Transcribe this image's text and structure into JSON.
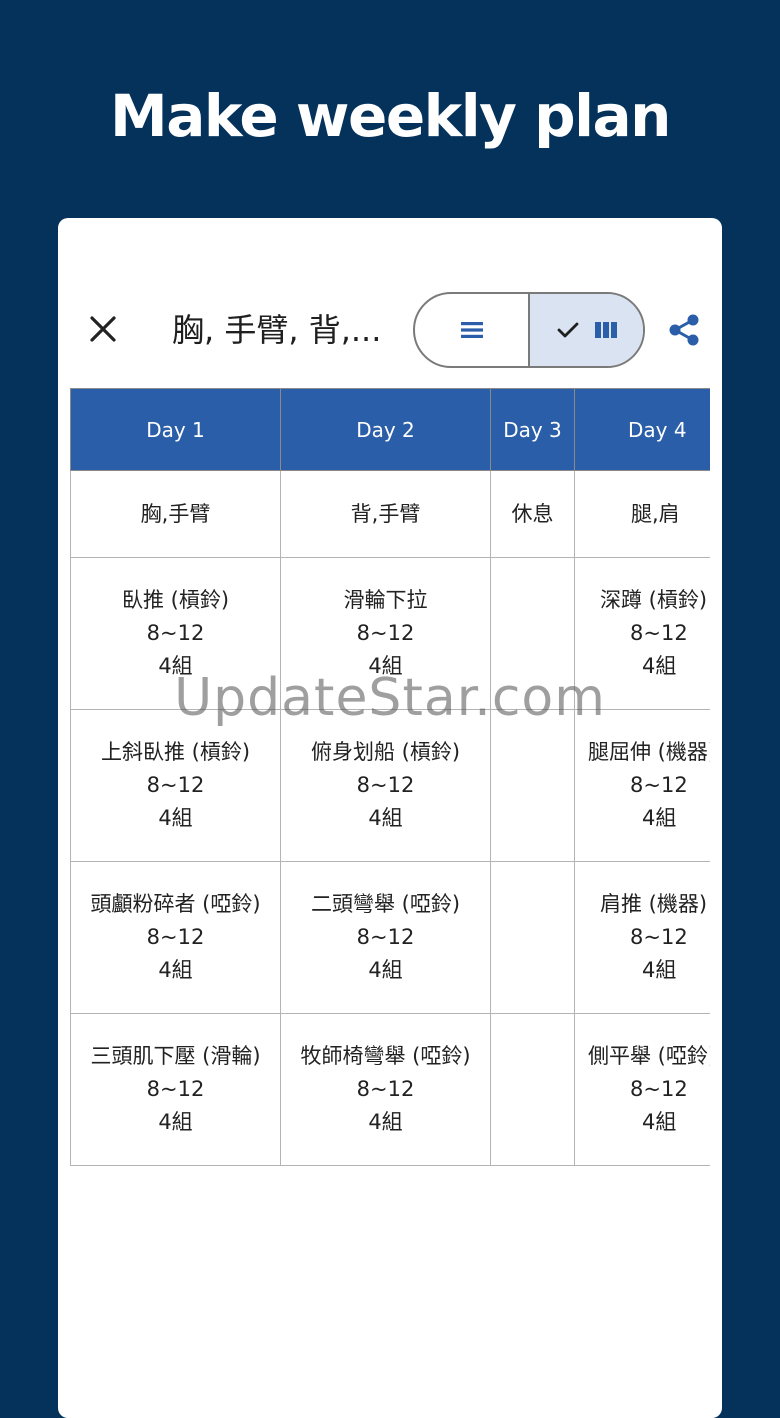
{
  "headline": "Make weekly plan",
  "toolbar": {
    "title": "胸, 手臂, 背,...",
    "close_icon": "close-icon",
    "list_view_icon": "list-icon",
    "grid_view_icon": "columns-icon",
    "selected_icon": "check-icon",
    "share_icon": "share-icon"
  },
  "colors": {
    "background": "#04325a",
    "header": "#2a5ea8",
    "toggle_selected": "#d9e3f2",
    "accent": "#2a5ea8"
  },
  "days": [
    {
      "label": "Day 1",
      "focus": "胸,手臂",
      "exercises": [
        {
          "name": "臥推 (槓鈴)",
          "reps": "8~12",
          "sets": "4組"
        },
        {
          "name": "上斜臥推 (槓鈴)",
          "reps": "8~12",
          "sets": "4組"
        },
        {
          "name": "頭顱粉碎者 (啞鈴)",
          "reps": "8~12",
          "sets": "4組"
        },
        {
          "name": "三頭肌下壓 (滑輪)",
          "reps": "8~12",
          "sets": "4組"
        }
      ]
    },
    {
      "label": "Day 2",
      "focus": "背,手臂",
      "exercises": [
        {
          "name": "滑輪下拉",
          "reps": "8~12",
          "sets": "4組"
        },
        {
          "name": "俯身划船 (槓鈴)",
          "reps": "8~12",
          "sets": "4組"
        },
        {
          "name": "二頭彎舉 (啞鈴)",
          "reps": "8~12",
          "sets": "4組"
        },
        {
          "name": "牧師椅彎舉 (啞鈴)",
          "reps": "8~12",
          "sets": "4組"
        }
      ]
    },
    {
      "label": "Day 3",
      "focus": "休息",
      "exercises": [
        {
          "name": "",
          "reps": "",
          "sets": ""
        },
        {
          "name": "",
          "reps": "",
          "sets": ""
        },
        {
          "name": "",
          "reps": "",
          "sets": ""
        },
        {
          "name": "",
          "reps": "",
          "sets": ""
        }
      ]
    },
    {
      "label": "Day 4",
      "focus": "腿,肩",
      "exercises": [
        {
          "name": "深蹲 (槓鈴)",
          "reps": "8~12",
          "sets": "4組"
        },
        {
          "name": "腿屈伸 (機器)",
          "reps": "8~12",
          "sets": "4組"
        },
        {
          "name": "肩推 (機器)",
          "reps": "8~12",
          "sets": "4組"
        },
        {
          "name": "側平舉 (啞鈴)",
          "reps": "8~12",
          "sets": "4組"
        }
      ]
    }
  ],
  "watermark": "UpdateStar.com"
}
